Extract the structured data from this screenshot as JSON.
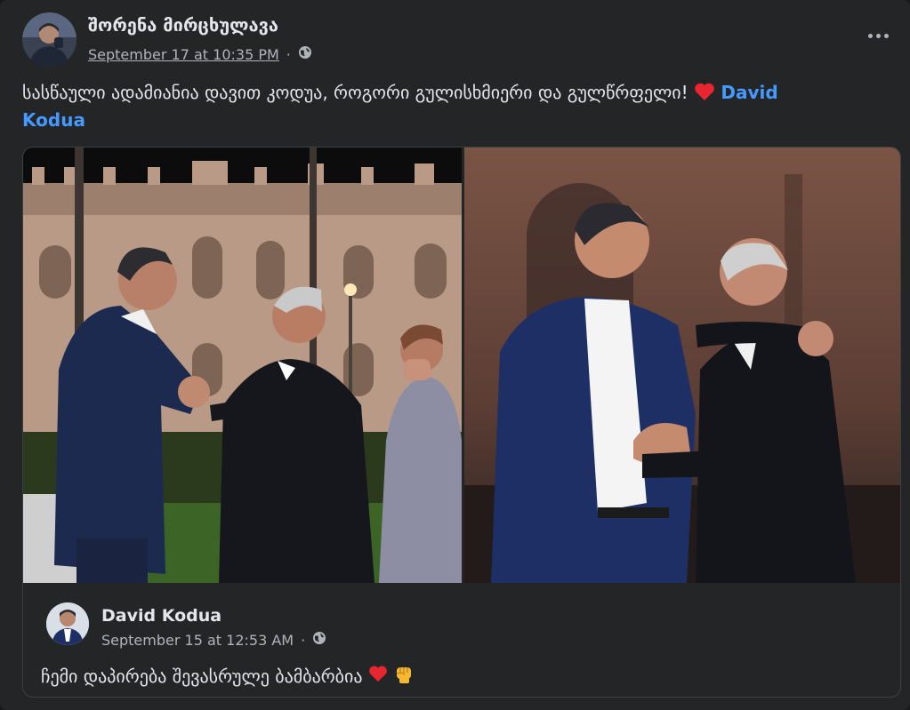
{
  "post": {
    "author": "შორენა მირცხულავა",
    "timestamp": "September 17 at 10:35 PM",
    "privacy_icon": "globe-icon",
    "text": "სასწაული ადამიანია დავით კოდუა, როგორი გულისხმიერი და გულწრფელი!",
    "emoji": "red-heart",
    "tag_name_line1": "David",
    "tag_name_line2": "Kodua",
    "more_icon": "more-options-icon"
  },
  "shared": {
    "author": "David Kodua",
    "timestamp": "September 15 at 12:53 AM",
    "privacy_icon": "globe-icon",
    "text": "ჩემი დაპირება შევასრულე ბამბარბია",
    "emojis": [
      "red-heart",
      "raised-fist"
    ]
  },
  "colors": {
    "background": "#242526",
    "text": "#e4e6eb",
    "secondary_text": "#b0b3b8",
    "link": "#4599ff",
    "border": "#3e4042"
  }
}
